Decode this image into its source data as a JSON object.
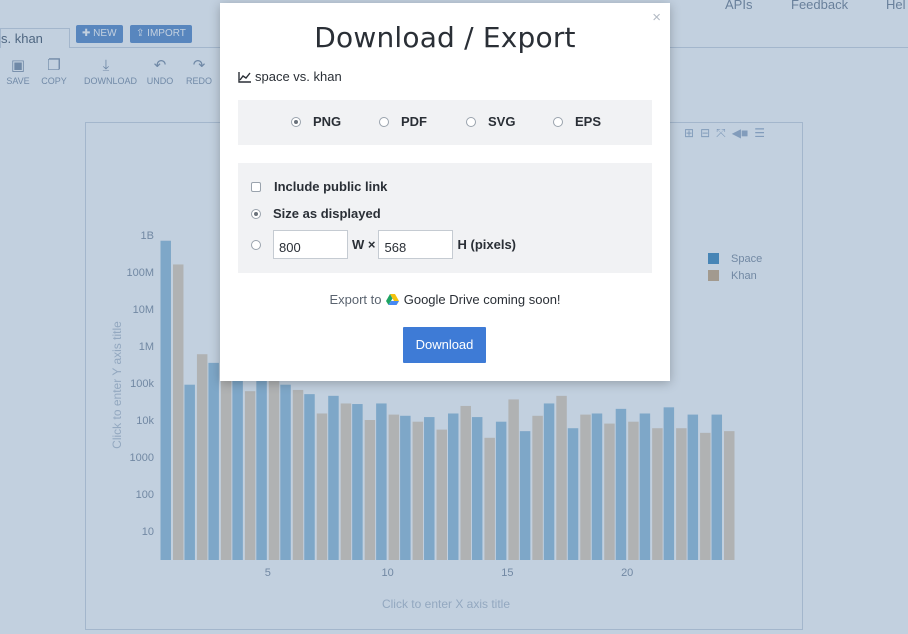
{
  "topnav": {
    "items": [
      "APIs",
      "Feedback",
      "Hel"
    ]
  },
  "tab": {
    "title": "s. khan"
  },
  "tab_buttons": {
    "new": "NEW",
    "import": "IMPORT"
  },
  "toolbar": {
    "save": "SAVE",
    "copy": "COPY",
    "download": "DOWNLOAD",
    "undo": "UNDO",
    "redo": "REDO"
  },
  "plot": {
    "y_axis_hint": "Click to enter Y axis title",
    "x_axis_hint": "Click to enter X axis title"
  },
  "chart_data": {
    "type": "bar",
    "yscale": "log",
    "ylim": [
      1,
      1000000000
    ],
    "yticks": [
      "10",
      "100",
      "1000",
      "10k",
      "100k",
      "1M",
      "10M",
      "100M",
      "1B"
    ],
    "xticks": [
      5,
      10,
      15,
      20
    ],
    "x": [
      1,
      2,
      3,
      4,
      5,
      6,
      7,
      8,
      9,
      10,
      11,
      12,
      13,
      14,
      15,
      16,
      17,
      18,
      19,
      20,
      21,
      22,
      23,
      24
    ],
    "series": [
      {
        "name": "Space",
        "color": "#1f77b4",
        "values": [
          700000000,
          90000,
          350000,
          160000,
          220000,
          90000,
          50000,
          45000,
          27000,
          28000,
          13000,
          12000,
          15000,
          12000,
          9000,
          5000,
          28000,
          6000,
          15000,
          20000,
          15000,
          22000,
          14000,
          14000
        ]
      },
      {
        "name": "Khan",
        "color": "#c59d6e",
        "values": [
          160000000,
          600000,
          170000,
          60000,
          200000,
          65000,
          15000,
          28000,
          10000,
          14000,
          9000,
          5500,
          24000,
          3300,
          36000,
          13000,
          45000,
          14000,
          8000,
          9000,
          6000,
          6000,
          4500,
          5000
        ]
      }
    ]
  },
  "modal": {
    "title": "Download / Export",
    "plot_name": "space vs. khan",
    "formats": [
      "PNG",
      "PDF",
      "SVG",
      "EPS"
    ],
    "selected_format": "PNG",
    "include_link_label": "Include public link",
    "size_displayed_label": "Size as displayed",
    "width": "800",
    "height": "568",
    "w_label": "W ×",
    "h_label": "H (pixels)",
    "export_prefix": "Export to",
    "export_service": "Google Drive coming soon!",
    "download_label": "Download",
    "close": "×"
  }
}
